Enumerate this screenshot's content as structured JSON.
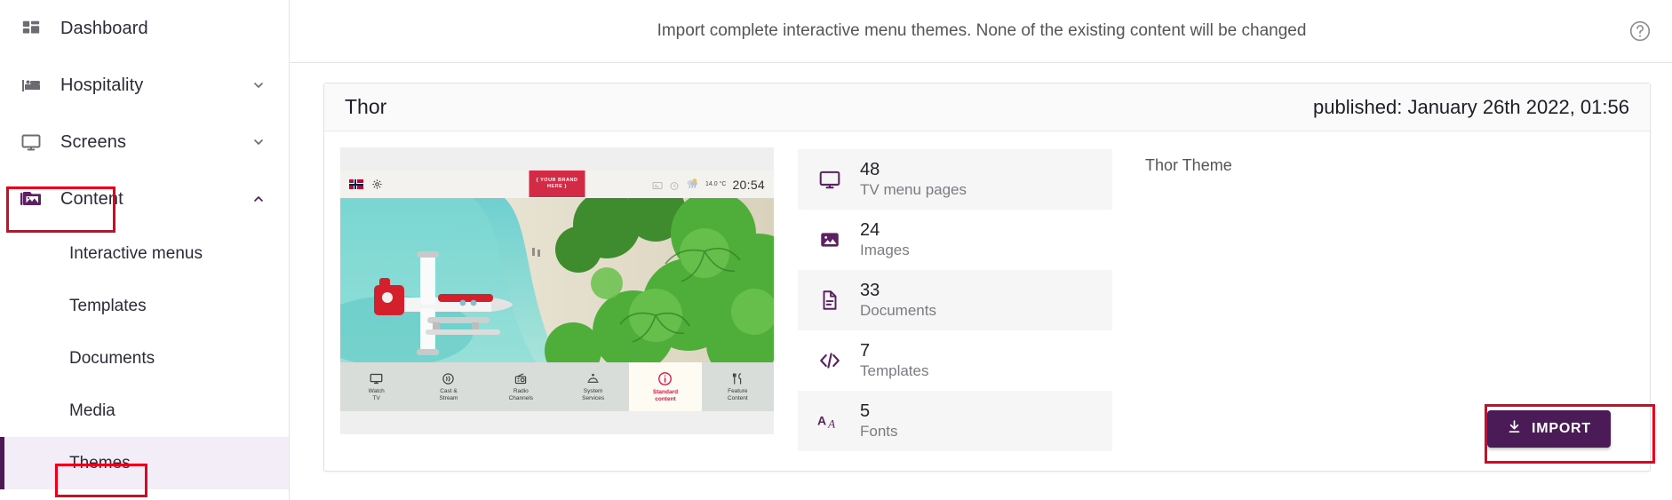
{
  "sidebar": {
    "items": [
      {
        "label": "Dashboard",
        "icon": "dashboard-icon",
        "expandable": false
      },
      {
        "label": "Hospitality",
        "icon": "bed-icon",
        "expandable": true,
        "chevron": "chevron-down-icon"
      },
      {
        "label": "Screens",
        "icon": "monitor-icon",
        "expandable": true,
        "chevron": "chevron-down-icon"
      },
      {
        "label": "Content",
        "icon": "content-image-icon",
        "expandable": true,
        "chevron": "chevron-up-icon",
        "highlighted": true
      }
    ],
    "sub_items": [
      {
        "label": "Interactive menus",
        "active": false
      },
      {
        "label": "Templates",
        "active": false
      },
      {
        "label": "Documents",
        "active": false
      },
      {
        "label": "Media",
        "active": false
      },
      {
        "label": "Themes",
        "active": true
      }
    ]
  },
  "topbar": {
    "message": "Import complete interactive menu themes. None of the existing content will be changed",
    "help_icon": "help-circle-icon"
  },
  "card": {
    "title": "Thor",
    "published": "published: January 26th 2022, 01:56",
    "description": "Thor Theme",
    "stats": [
      {
        "count": "48",
        "label": "TV menu pages",
        "icon": "monitor-icon"
      },
      {
        "count": "24",
        "label": "Images",
        "icon": "image-icon"
      },
      {
        "count": "33",
        "label": "Documents",
        "icon": "document-icon"
      },
      {
        "count": "7",
        "label": "Templates",
        "icon": "code-icon"
      },
      {
        "count": "5",
        "label": "Fonts",
        "icon": "font-icon"
      }
    ],
    "import_button": "IMPORT",
    "import_icon": "download-icon"
  },
  "tv_preview": {
    "clock": "20:54",
    "temperature": "14.0 °C",
    "brand_badge": "{ YOUR BRAND HERE }",
    "flag_icon": "norway-flag-icon",
    "settings_icon": "gear-icon",
    "menu": [
      {
        "caption": "Watch\nTV",
        "icon": "tv-icon",
        "selected": false
      },
      {
        "caption": "Cast &\nStream",
        "icon": "cast-icon",
        "selected": false
      },
      {
        "caption": "Radio\nChannels",
        "icon": "radio-icon",
        "selected": false
      },
      {
        "caption": "System\nServices",
        "icon": "roomservice-icon",
        "selected": false
      },
      {
        "caption": "Standard\ncontent",
        "icon": "info-icon",
        "selected": true
      },
      {
        "caption": "Feature\nContent",
        "icon": "cutlery-icon",
        "selected": false
      }
    ]
  },
  "colors": {
    "accent_purple": "#4b1b58",
    "annotation_red": "#e8001c",
    "active_sidebar_bg": "#f2edf7",
    "tv_accent_red": "#e0144c"
  }
}
